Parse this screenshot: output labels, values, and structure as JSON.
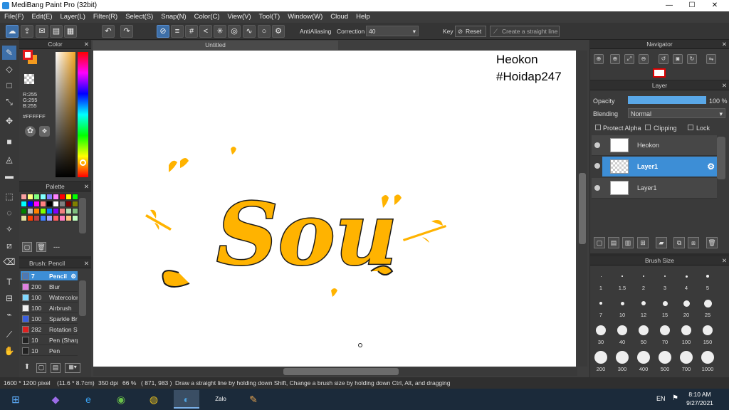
{
  "app": {
    "title": "MediBang Paint Pro (32bit)",
    "window_controls": [
      "—",
      "☐",
      "✕"
    ]
  },
  "menu": [
    "File(F)",
    "Edit(E)",
    "Layer(L)",
    "Filter(R)",
    "Select(S)",
    "Snap(N)",
    "Color(C)",
    "View(V)",
    "Tool(T)",
    "Window(W)",
    "Cloud",
    "Help"
  ],
  "toolbar": {
    "antialias_label": "AntiAliasing",
    "correction_label": "Correction",
    "correction_value": "40",
    "key_label": "Key",
    "reset_label": "Reset",
    "straight_line_label": "Create a straight line"
  },
  "color_panel": {
    "title": "Color",
    "r": "R:255",
    "g": "G:255",
    "b": "B:255",
    "hex": "#FFFFFF",
    "fg": "#e8181a",
    "bg": "#f39a1e"
  },
  "palette": {
    "title": "Palette",
    "colors": [
      "#f9a0a0",
      "#ffff80",
      "#80ff80",
      "#80ffff",
      "#8080ff",
      "#ff80ff",
      "#ff0000",
      "#ffff00",
      "#00ff00",
      "#00ffff",
      "#0000ff",
      "#ff00ff",
      "#ff8080",
      "#000000",
      "#ffffff",
      "#808080",
      "#800000",
      "#808000",
      "#008000",
      "#c0c0c0",
      "#ff8000",
      "#80ff00",
      "#0080ff",
      "#8000ff",
      "#f08080",
      "#b0e0b0",
      "#80c080",
      "#e0e0a0",
      "#ff4000",
      "#c04040",
      "#4080ff",
      "#a0a0ff",
      "#ff6060",
      "#ff80c0",
      "#ffc080",
      "#c0ffc0"
    ],
    "footer": "---"
  },
  "brush_panel": {
    "title": "Brush: Pencil",
    "items": [
      {
        "size": "7",
        "name": "Pencil",
        "color": "#4a79b8"
      },
      {
        "size": "200",
        "name": "Blur",
        "color": "#e080e0"
      },
      {
        "size": "100",
        "name": "Watercolor",
        "color": "#80d8ff"
      },
      {
        "size": "100",
        "name": "Airbrush",
        "color": "#f0f0f0"
      },
      {
        "size": "100",
        "name": "Sparkle Brush",
        "color": "#3a5fe0"
      },
      {
        "size": "282",
        "name": "Rotation Symmetry",
        "color": "#e02020"
      },
      {
        "size": "10",
        "name": "Pen (Sharp)",
        "color": "#222222"
      },
      {
        "size": "10",
        "name": "Pen",
        "color": "#222222"
      }
    ]
  },
  "document": {
    "tab": "Untitled",
    "watermark_line1": "Heokon",
    "watermark_line2": "#Hoidap247",
    "artwork_word": "Sou",
    "artwork_color": "#ffb300"
  },
  "navigator": {
    "title": "Navigator"
  },
  "layer_panel": {
    "title": "Layer",
    "opacity_label": "Opacity",
    "opacity_value": "100 %",
    "opacity_fraction": 1.0,
    "blending_label": "Blending",
    "blending_value": "Normal",
    "protect_alpha": "Protect Alpha",
    "clipping": "Clipping",
    "lock": "Lock",
    "layers": [
      {
        "name": "Heokon",
        "selected": false
      },
      {
        "name": "Layer1",
        "selected": true
      },
      {
        "name": "Layer1",
        "selected": false
      }
    ]
  },
  "brush_size": {
    "title": "Brush Size",
    "sizes": [
      "1",
      "1.5",
      "2",
      "3",
      "4",
      "5",
      "7",
      "10",
      "12",
      "15",
      "20",
      "25",
      "30",
      "40",
      "50",
      "70",
      "100",
      "150",
      "200",
      "300",
      "400",
      "500",
      "700",
      "1000"
    ]
  },
  "status": {
    "dimensions": "1600 * 1200 pixel",
    "physical": "(11.6 * 8.7cm)",
    "dpi": "350 dpi",
    "zoom": "66 %",
    "coords": "( 871, 983 )",
    "hint": "Draw a straight line by holding down Shift, Change a brush size by holding down Ctrl, Alt, and dragging"
  },
  "taskbar": {
    "lang": "EN",
    "time": "8:10 AM",
    "date": "9/27/2021",
    "zalo": "Zalo"
  }
}
